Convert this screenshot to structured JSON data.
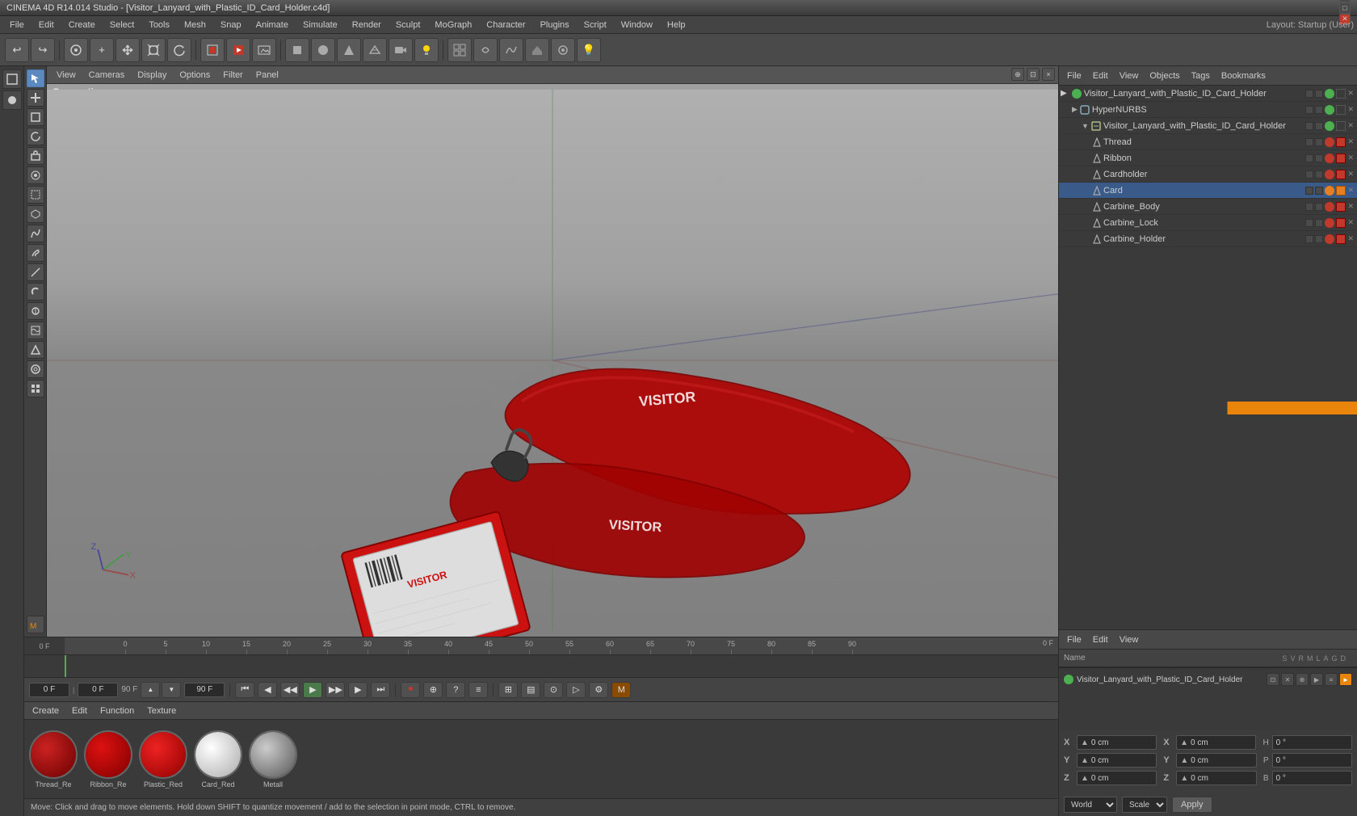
{
  "app": {
    "title": "CINEMA 4D R14.014 Studio - [Visitor_Lanyard_with_Plastic_ID_Card_Holder.c4d]",
    "layout_label": "Layout: Startup (User)"
  },
  "menubar": {
    "items": [
      "File",
      "Edit",
      "Create",
      "Select",
      "Tools",
      "Mesh",
      "Snap",
      "Animate",
      "Simulate",
      "Render",
      "Sculpt",
      "MoGraph",
      "Character",
      "Plugins",
      "Script",
      "Window",
      "Help"
    ]
  },
  "viewport": {
    "label": "Perspective",
    "menus": [
      "View",
      "Cameras",
      "Display",
      "Options",
      "Filter",
      "Panel"
    ]
  },
  "right_panel": {
    "title": "Visitor_Lanyard_with_Plastic_ID_Card_Holder",
    "toolbar_menus": [
      "File",
      "Edit",
      "View",
      "Objects",
      "Tags",
      "Bookmarks"
    ],
    "hierarchy": [
      {
        "name": "Visitor_Lanyard_with_Plastic_ID_Card_Holder",
        "level": 0,
        "type": "group",
        "color": "#4caf50",
        "expanded": true
      },
      {
        "name": "HyperNURBS",
        "level": 1,
        "type": "nurbs",
        "color": "#4caf50",
        "expanded": true
      },
      {
        "name": "Visitor_Lanyard_with_Plastic_ID_Card_Holder",
        "level": 2,
        "type": "group",
        "color": "#4caf50",
        "expanded": true
      },
      {
        "name": "Thread",
        "level": 3,
        "type": "mesh",
        "color": "#c0392b"
      },
      {
        "name": "Ribbon",
        "level": 3,
        "type": "mesh",
        "color": "#c0392b"
      },
      {
        "name": "Cardholder",
        "level": 3,
        "type": "mesh",
        "color": "#c0392b"
      },
      {
        "name": "Card",
        "level": 3,
        "type": "mesh",
        "color": "#c0392b"
      },
      {
        "name": "Carbine_Body",
        "level": 3,
        "type": "mesh",
        "color": "#c0392b"
      },
      {
        "name": "Carbine_Lock",
        "level": 3,
        "type": "mesh",
        "color": "#c0392b"
      },
      {
        "name": "Carbine_Holder",
        "level": 3,
        "type": "mesh",
        "color": "#c0392b"
      }
    ]
  },
  "coord_panel": {
    "toolbar_menus": [
      "File",
      "Edit",
      "View"
    ],
    "header_col": "Name",
    "extra_item": {
      "name": "Visitor_Lanyard_with_Plastic_ID_Card_Holder",
      "dot_color": "#4caf50"
    },
    "coords": {
      "x_pos": "0 cm",
      "y_pos": "0 cm",
      "z_pos": "0 cm",
      "x_size": "0 cm",
      "y_size": "0 cm",
      "z_size": "0 cm",
      "p_rot": "0 °",
      "h_rot": "0 °",
      "b_rot": "0 °"
    },
    "controls": {
      "world_label": "World",
      "scale_label": "Scale",
      "apply_label": "Apply"
    }
  },
  "timeline": {
    "start_frame": "0 F",
    "end_frame": "90 F",
    "current_frame": "0 F",
    "current_frame2": "0 F",
    "max_frame": "90 F",
    "ruler_marks": [
      "0",
      "5",
      "10",
      "15",
      "20",
      "25",
      "30",
      "35",
      "40",
      "45",
      "50",
      "55",
      "60",
      "65",
      "70",
      "75",
      "80",
      "85",
      "90"
    ]
  },
  "materials": [
    {
      "name": "Thread_Re",
      "color": "#8b0000"
    },
    {
      "name": "Ribbon_Re",
      "color": "#a00000"
    },
    {
      "name": "Plastic_Red",
      "color": "#b00000"
    },
    {
      "name": "Card_Red",
      "color": "#cccccc"
    },
    {
      "name": "Metall",
      "color": "#888888"
    }
  ],
  "mat_toolbar": {
    "menus": [
      "Create",
      "Edit",
      "Function",
      "Texture"
    ]
  },
  "statusbar": {
    "text": "Move: Click and drag to move elements. Hold down SHIFT to quantize movement / add to the selection in point mode, CTRL to remove."
  },
  "icons": {
    "undo": "↩",
    "redo": "↪",
    "new": "+",
    "open": "📂",
    "move": "✥",
    "scale": "⊞",
    "rotate": "↻",
    "play": "▶",
    "pause": "⏸",
    "stop": "■",
    "prev": "⏮",
    "next": "⏭",
    "rewind": "◀◀",
    "forward": "▶▶",
    "record": "⏺",
    "key": "🔑",
    "help": "?",
    "plus": "+",
    "grid": "⊞",
    "sphere": "●",
    "cone": "▲",
    "cube": "■",
    "camera": "📷",
    "light": "💡"
  }
}
